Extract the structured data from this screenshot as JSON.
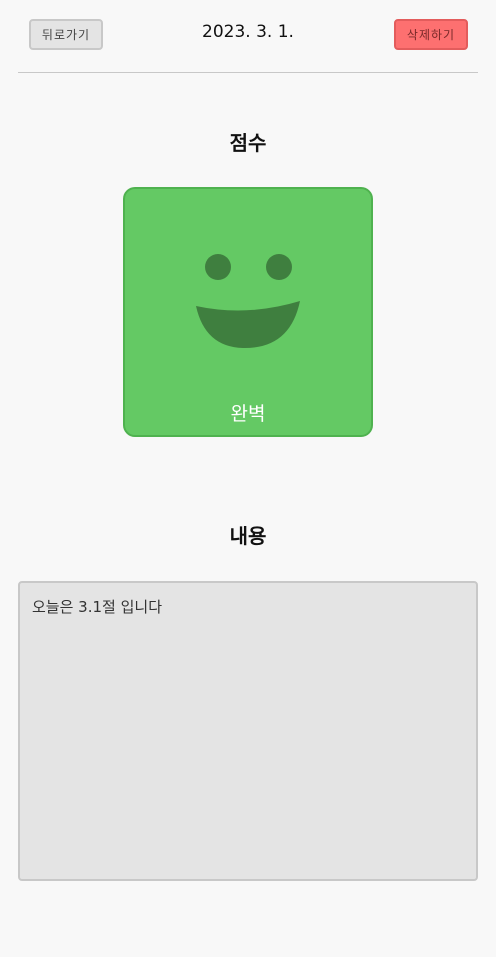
{
  "header": {
    "back_label": "뒤로가기",
    "date": "2023. 3. 1.",
    "delete_label": "삭제하기"
  },
  "score": {
    "title": "점수",
    "label": "완벽",
    "icon": "smile-face-icon",
    "color": "#64c964"
  },
  "content": {
    "title": "내용",
    "text": "오늘은 3.1절 입니다"
  }
}
